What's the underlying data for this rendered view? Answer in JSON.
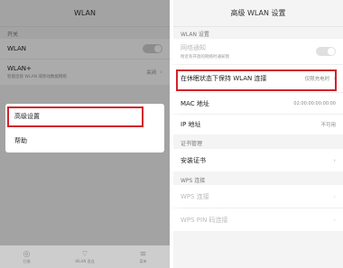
{
  "left": {
    "title": "WLAN",
    "section_switch": "开关",
    "wlan_label": "WLAN",
    "wlan_plus_label": "WLAN+",
    "wlan_plus_sub": "智能连接 WLAN 或移动数据网络",
    "wlan_plus_value": "关闭",
    "menu": [
      "高级设置",
      "帮助"
    ],
    "bottom_bar": [
      "扫描",
      "WLAN 直连",
      "菜单"
    ]
  },
  "right": {
    "title": "高级 WLAN 设置",
    "section_wlan": "WLAN 设置",
    "notify_label": "网络通知",
    "notify_sub": "附近有开放的网络时通知我",
    "keep_label": "在休眠状态下保持 WLAN 连接",
    "keep_value": "仅限充电时",
    "mac_label": "MAC 地址",
    "mac_value": "02:00:00:00:00:00",
    "ip_label": "IP 地址",
    "ip_value": "不可用",
    "section_cert": "证书管理",
    "cert_label": "安装证书",
    "section_wps": "WPS 连接",
    "wps_label": "WPS 连接",
    "wps_pin_label": "WPS PIN 码连接"
  },
  "colors": {
    "highlight": "#d2222b",
    "toggle_off": "#d0d0d0"
  }
}
